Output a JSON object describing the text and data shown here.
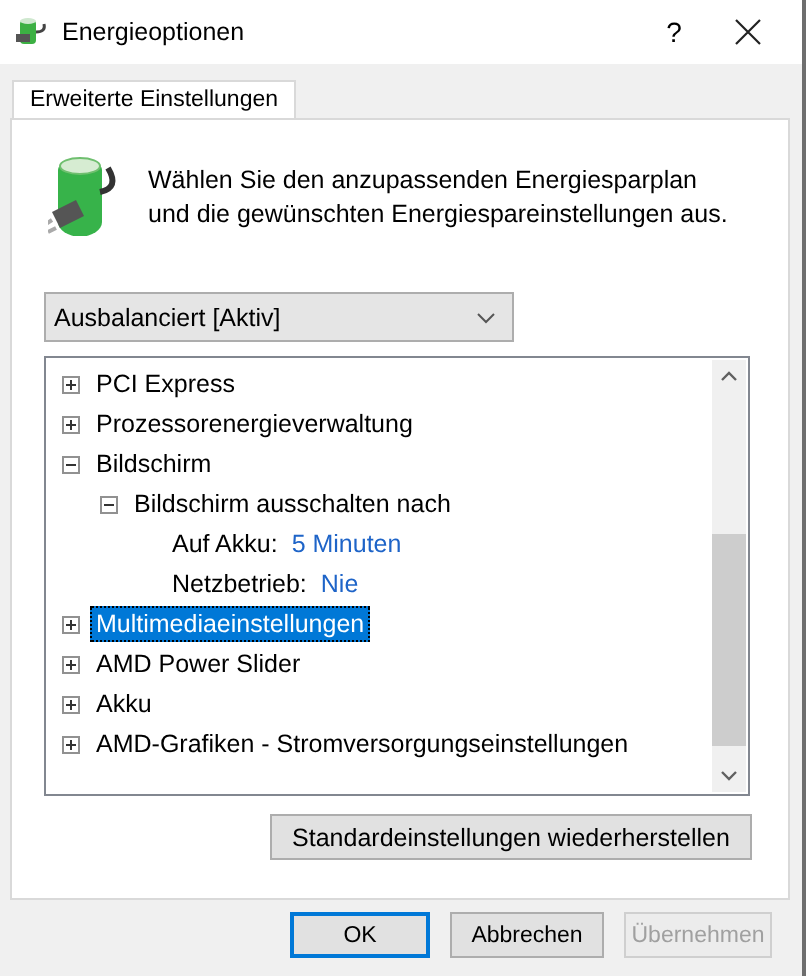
{
  "window": {
    "title": "Energieoptionen",
    "help_button": "?"
  },
  "tabs": [
    {
      "label": "Erweiterte Einstellungen",
      "selected": true
    }
  ],
  "intro": "Wählen Sie den anzupassenden Energiesparplan\nund die gewünschten Energiespareinstellungen aus.",
  "plan_dropdown": {
    "value": "Ausbalanciert [Aktiv]"
  },
  "settings_tree": [
    {
      "kind": "group",
      "label": "PCI Express",
      "expanded": false,
      "selected": false
    },
    {
      "kind": "group",
      "label": "Prozessorenergieverwaltung",
      "expanded": false,
      "selected": false
    },
    {
      "kind": "group",
      "label": "Bildschirm",
      "expanded": true,
      "selected": false,
      "children": [
        {
          "kind": "group",
          "label": "Bildschirm ausschalten nach",
          "expanded": true,
          "selected": false,
          "children": [
            {
              "kind": "value",
              "label": "Auf Akku:",
              "value": "5 Minuten",
              "selected": false
            },
            {
              "kind": "value",
              "label": "Netzbetrieb:",
              "value": "Nie",
              "selected": false
            }
          ]
        }
      ]
    },
    {
      "kind": "group",
      "label": "Multimediaeinstellungen",
      "expanded": false,
      "selected": true
    },
    {
      "kind": "group",
      "label": "AMD Power Slider",
      "expanded": false,
      "selected": false
    },
    {
      "kind": "group",
      "label": "Akku",
      "expanded": false,
      "selected": false
    },
    {
      "kind": "group",
      "label": "AMD-Grafiken - Stromversorgungseinstellungen",
      "expanded": false,
      "selected": false
    }
  ],
  "restore_button": "Standardeinstellungen wiederherstellen",
  "buttons": [
    {
      "label": "OK",
      "default": true,
      "disabled": false
    },
    {
      "label": "Abbrechen",
      "default": false,
      "disabled": false
    },
    {
      "label": "Übernehmen",
      "default": false,
      "disabled": true
    }
  ]
}
